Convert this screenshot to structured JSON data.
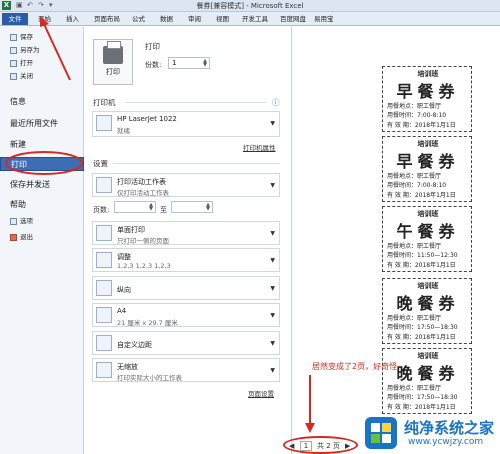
{
  "window": {
    "app_icon": "X",
    "qa_items": [
      "save-icon",
      "undo-icon",
      "redo-icon",
      "dropdown-icon"
    ],
    "title": "餐券[兼容模式] - Microsoft Excel"
  },
  "ribbon_tabs": [
    "文件",
    "开始",
    "插入",
    "页面布局",
    "公式",
    "数据",
    "审阅",
    "视图",
    "开发工具",
    "百度网盘",
    "易用宝"
  ],
  "nav": {
    "commands": [
      "保存",
      "另存为",
      "打开",
      "关闭"
    ],
    "items": [
      "信息",
      "最近所用文件",
      "新建",
      "打印",
      "保存并发送",
      "帮助"
    ],
    "bottom_commands": [
      "选项",
      "退出"
    ]
  },
  "print": {
    "section_title": "打印",
    "print_button": "打印",
    "copies_label": "份数:",
    "copies_value": "1",
    "printer_title": "打印机",
    "printer_name": "HP LaserJet 1022",
    "printer_status": "就绪",
    "printer_properties": "打印机属性",
    "settings_title": "设置",
    "what_to_print": "打印活动工作表",
    "what_to_print_sub": "仅打印活动工作表",
    "pages_label": "页数:",
    "pages_to": "至",
    "sides": "单面打印",
    "sides_sub": "只打印一侧的页面",
    "collate": "调整",
    "collate_sub": "1,2,3    1,2,3    1,2,3",
    "orientation": "纵向",
    "paper": "A4",
    "paper_sub": "21 厘米 x 29.7 厘米",
    "margins": "自定义边距",
    "scaling": "无缩放",
    "scaling_sub": "打印实际大小的工作表",
    "page_setup": "页面设置",
    "info_icon": "info-icon"
  },
  "preview": {
    "tickets": [
      {
        "org": "培训班",
        "meal": "早餐券",
        "place": "用餐地点：职工餐厅",
        "time": "用餐时间：7:00-8:10",
        "valid": "有  效  期：2018年1月1日"
      },
      {
        "org": "培训班",
        "meal": "早餐券",
        "place": "用餐地点：职工餐厅",
        "time": "用餐时间：7:00-8:10",
        "valid": "有  效  期：2018年1月1日"
      },
      {
        "org": "培训班",
        "meal": "午餐券",
        "place": "用餐地点：职工餐厅",
        "time": "用餐时间：11:50—12:30",
        "valid": "有  效  期：2018年1月1日"
      },
      {
        "org": "培训班",
        "meal": "晚餐券",
        "place": "用餐地点：职工餐厅",
        "time": "用餐时间：17:50—18:30",
        "valid": "有  效  期：2018年1月1日"
      },
      {
        "org": "培训班",
        "meal": "晚餐券",
        "place": "用餐地点：职工餐厅",
        "time": "用餐时间：17:50—18:30",
        "valid": "有  效  期：2018年1月1日"
      }
    ],
    "annotation": "居然变成了2页，好奇怪",
    "page_current": "1",
    "page_total": "共 2 页"
  },
  "watermark": {
    "title": "纯净系统之家",
    "url": "www.ycwjzy.com"
  },
  "colors": {
    "accent": "#3d6eb5",
    "annotation": "#d9281e",
    "excel_green": "#1d7a3a"
  }
}
